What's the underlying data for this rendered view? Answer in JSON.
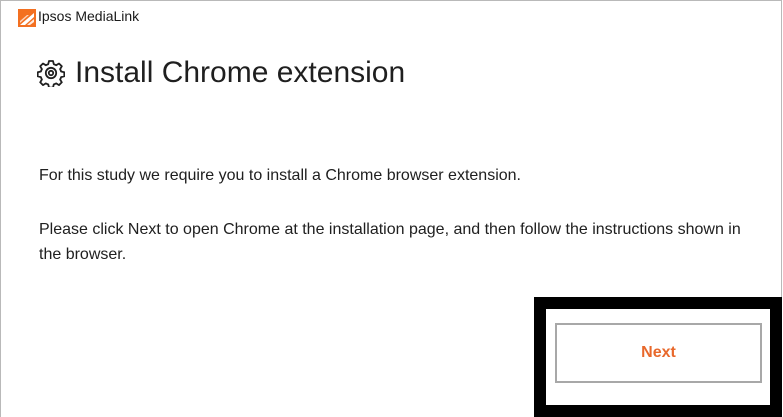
{
  "window": {
    "app_title": "Ipsos MediaLink",
    "logo_icon": "ipsos-logo-icon"
  },
  "main": {
    "title_icon": "gear-icon",
    "title": "Install Chrome extension",
    "paragraphs": [
      "For this study we require you to install a Chrome browser extension.",
      "Please click Next to open Chrome at the installation page, and then follow the instructions shown in the browser."
    ]
  },
  "actions": {
    "next_label": "Next"
  },
  "colors": {
    "accent": "#e8682b",
    "highlight_frame": "#000000",
    "button_border": "#a8a8a8"
  }
}
